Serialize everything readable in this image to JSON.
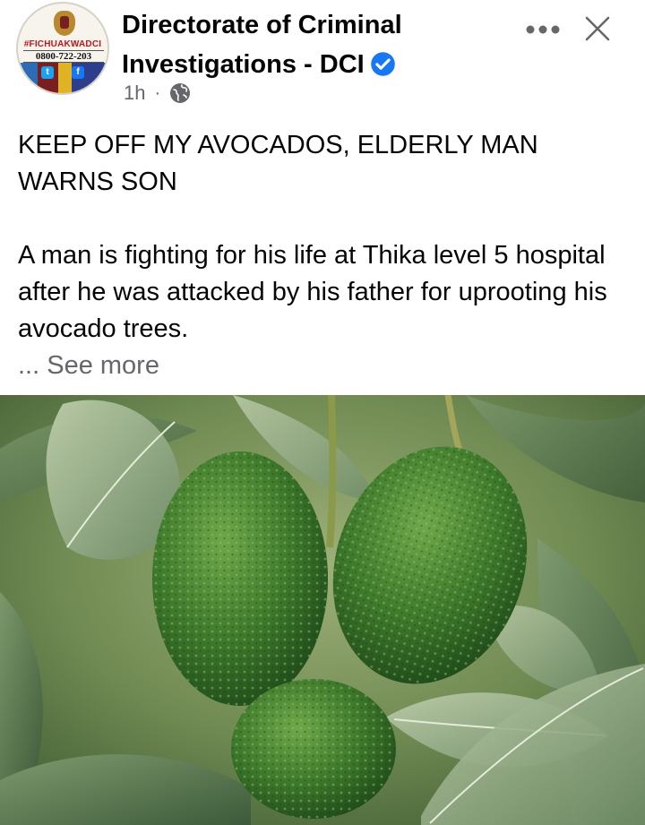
{
  "post": {
    "page_name": "Directorate of Criminal Investigations - DCI",
    "timestamp": "1h",
    "separator": "·",
    "verified": true,
    "privacy_icon": "globe-icon",
    "headline": "KEEP OFF MY AVOCADOS, ELDERLY MAN WARNS SON",
    "body": "A man is fighting for his life at Thika level 5 hospital after he was attacked by his father for uprooting his avocado trees.",
    "see_more": "... See more"
  },
  "avatar": {
    "hashtag": "#FICHUAKWADCI",
    "phone": "0800-722-203"
  },
  "icons": {
    "more": "more-horizontal-icon",
    "close": "close-icon",
    "verified": "verified-badge-icon"
  },
  "colors": {
    "verified_blue": "#1877f2",
    "meta_gray": "#65676b",
    "text": "#050505"
  }
}
